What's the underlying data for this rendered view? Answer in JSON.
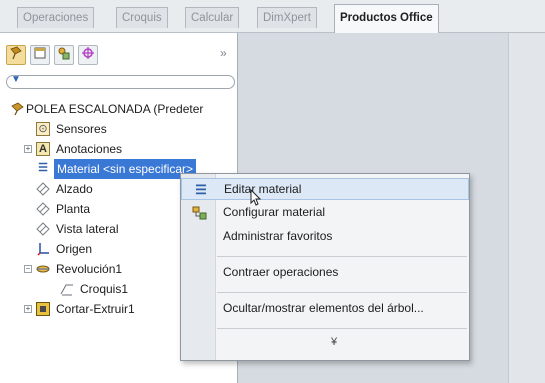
{
  "tabs": [
    {
      "label": "Operaciones",
      "active": false
    },
    {
      "label": "Croquis",
      "active": false
    },
    {
      "label": "Calcular",
      "active": false
    },
    {
      "label": "DimXpert",
      "active": false
    },
    {
      "label": "Productos Office",
      "active": true
    }
  ],
  "panel": {
    "toolbar_icons": [
      "feature-manager-icon",
      "property-manager-icon",
      "configuration-manager-icon",
      "dimxpert-manager-icon"
    ],
    "toolbar_more": "»",
    "filter_icon": "filter-icon"
  },
  "tree": {
    "root": {
      "label": "POLEA ESCALONADA  (Predeter",
      "icon": "part-icon"
    },
    "items": [
      {
        "label": "Sensores",
        "icon": "sensor-icon"
      },
      {
        "label": "Anotaciones",
        "icon": "annotation-icon"
      },
      {
        "label": "Material <sin especificar>",
        "icon": "material-icon",
        "selected": true
      },
      {
        "label": "Alzado",
        "icon": "plane-icon"
      },
      {
        "label": "Planta",
        "icon": "plane-icon"
      },
      {
        "label": "Vista lateral",
        "icon": "plane-icon"
      },
      {
        "label": "Origen",
        "icon": "origin-icon"
      },
      {
        "label": "Revolución1",
        "icon": "revolve-icon"
      },
      {
        "label": "Croquis1",
        "icon": "sketch-icon"
      },
      {
        "label": "Cortar-Extruir1",
        "icon": "cut-extrude-icon"
      }
    ]
  },
  "context_menu": {
    "items": [
      {
        "label": "Editar material",
        "icon": "material-icon",
        "hover": true
      },
      {
        "label": "Configurar material",
        "icon": "configure-material-icon"
      },
      {
        "label": "Administrar favoritos",
        "icon": ""
      },
      {
        "label": "Contraer operaciones",
        "icon": ""
      },
      {
        "label": "Ocultar/mostrar elementos del árbol...",
        "icon": ""
      }
    ],
    "more": "¥"
  },
  "colors": {
    "selection": "#3a78d6",
    "menu_hover": "#dce8f6",
    "graphics_bg": "#d6dbe1"
  }
}
